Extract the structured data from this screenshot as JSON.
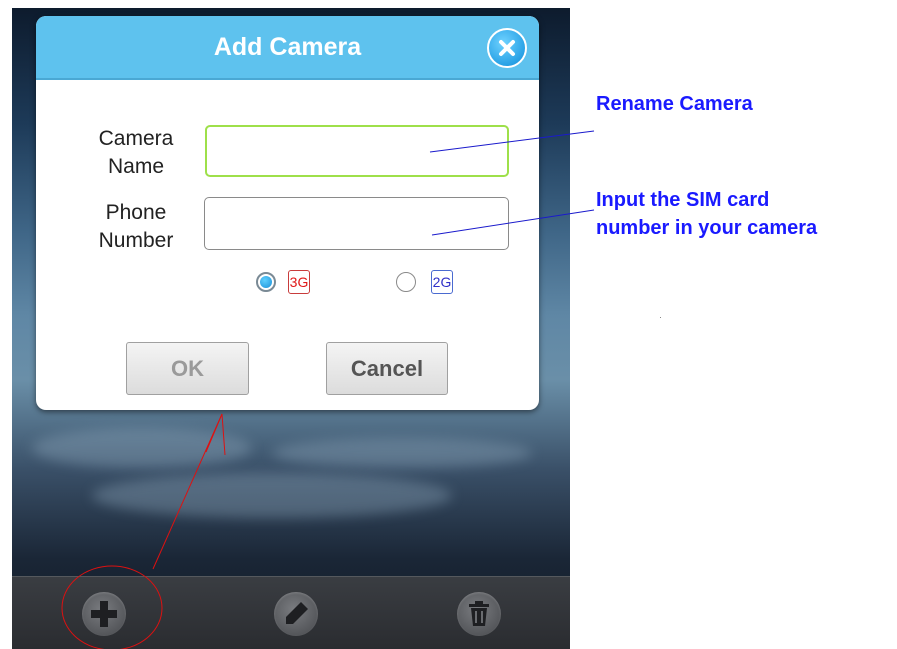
{
  "dialog": {
    "title": "Add Camera",
    "camera_name_label_line1": "Camera",
    "camera_name_label_line2": "Name",
    "camera_name_value": "",
    "phone_number_label_line1": "Phone",
    "phone_number_label_line2": "Number",
    "phone_number_value": "",
    "network_options": [
      {
        "label": "3G",
        "selected": true
      },
      {
        "label": "2G",
        "selected": false
      }
    ],
    "ok_label": "OK",
    "cancel_label": "Cancel"
  },
  "toolbar": {
    "icons": [
      "add-icon",
      "edit-icon",
      "trash-icon"
    ]
  },
  "annotations": {
    "rename": "Rename Camera",
    "sim_line1": "Input the SIM card",
    "sim_line2": "number in your camera"
  },
  "colors": {
    "header": "#5ec2ee",
    "annotation_text": "#1a1aff",
    "annotation_line": "#1a1acc",
    "arrow": "#dd1111"
  }
}
